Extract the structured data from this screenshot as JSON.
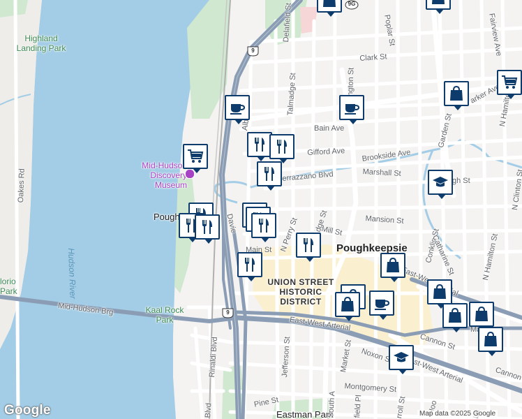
{
  "map": {
    "colors": {
      "water": "#a3cde6",
      "land": "#f4f3f1",
      "park": "#cfe8cf",
      "highway": "#8a9db5",
      "district": "#faf0d0",
      "marker": "#0d3b6b"
    },
    "labels": {
      "highland_landing_park": "Highland Landing Park",
      "oakes_rd": "Oakes Rd",
      "hudson_river": "Hudson River",
      "lorio_park": "lorio Park",
      "mid_hudson_museum": "Mid-Hudson Discovery Museum",
      "poughkeepsie_station": "Pough",
      "kaal_rock_park": "Kaal Rock Park",
      "mid_hudson_brg": "Mid-Hudson Brg",
      "rinaldi_blvd": "Rinaldi Blvd",
      "delafield_st": "Delafield St",
      "talmadge_st": "Talmadge St",
      "albany": "Alb",
      "poplar_st": "Poplar St",
      "clark_st": "Clark St",
      "washington_st": "ington St",
      "bain_ave": "Bain Ave",
      "gifford_ave": "Gifford Ave",
      "brookside_ave": "Brookside Ave",
      "verrazzano_blvd": "errazzano Blvd",
      "marshall_st": "Marshall St",
      "garden_st": "Garden St",
      "parker_ave": "arker Ave",
      "fairview_ave": "Fairview Ave",
      "n_hamilton": "N Hamilton",
      "n_clinton_st": "N Clinton St",
      "high_st": "gh St",
      "mansion_st": "Mansion St",
      "mill_st": "Mill St",
      "dge_st": "dge St",
      "n_perry_st": "N Perry St",
      "davies": "Davie",
      "main_st": "Main St",
      "main_st_east": "Main St",
      "poughkeepsie": "Poughkeepsie",
      "union_street": "UNION STREET HISTORIC DISTRICT",
      "conklin_st": "Conklin St",
      "catharine_st": "Catharine St",
      "n_hamilton_st": "N Hamilton St",
      "east_west_arterial_1": "East-West Arterial",
      "east_west_arterial_2": "East-West Arterial",
      "east_west_arterial_3": "East-West Arterial",
      "east_west_arterial_4": "ast-West Arterial",
      "jefferson_st": "Jefferson St",
      "market_st": "Market St",
      "noxon_st": "Noxon St",
      "cannon_st": "Cannon St",
      "cannon_2": "Cannon",
      "montgomery_st": "Montgomery St",
      "pine_st": "Pine St",
      "eastman_park": "Eastman Park",
      "south": "South A",
      "field_pl": "field Pl",
      "rroll_st": "rroll St",
      "hoo": "Hoo",
      "lafay": "La",
      "blvd": "Blvd"
    },
    "shields": {
      "us9_north": "9",
      "us9_south": "9",
      "rt9g": "9G"
    },
    "credits": {
      "logo": "Google",
      "data": "Map data ©2025 Google"
    }
  },
  "markers": [
    {
      "type": "coffee-icon"
    },
    {
      "type": "coffee-icon"
    },
    {
      "type": "coffee-icon"
    },
    {
      "type": "shopping-cart-icon"
    },
    {
      "type": "shopping-cart-icon"
    },
    {
      "type": "shopping-bag-icon"
    },
    {
      "type": "shopping-bag-icon"
    },
    {
      "type": "shopping-bag-icon"
    },
    {
      "type": "shopping-bag-icon"
    },
    {
      "type": "shopping-bag-icon"
    },
    {
      "type": "shopping-bag-icon"
    },
    {
      "type": "shopping-bag-icon"
    },
    {
      "type": "school-icon"
    },
    {
      "type": "school-icon"
    },
    {
      "type": "restaurant-icon"
    }
  ]
}
